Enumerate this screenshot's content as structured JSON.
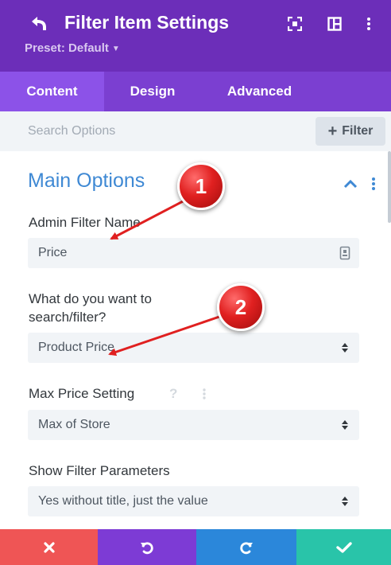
{
  "header": {
    "title": "Filter Item Settings",
    "preset_label": "Preset: Default",
    "icons": [
      "back-icon",
      "focus-icon",
      "layout-icon",
      "more-icon"
    ]
  },
  "tabs": [
    {
      "label": "Content",
      "active": true
    },
    {
      "label": "Design",
      "active": false
    },
    {
      "label": "Advanced",
      "active": false
    }
  ],
  "search": {
    "placeholder": "Search Options",
    "filter_label": "Filter"
  },
  "section": {
    "title": "Main Options"
  },
  "fields": [
    {
      "label": "Admin Filter Name",
      "value": "Price",
      "type": "text"
    },
    {
      "label_line1": "What do you want to",
      "label_line2": "search/filter?",
      "value": "Product Price",
      "type": "select"
    },
    {
      "label": "Max Price Setting",
      "value": "Max of Store",
      "type": "select",
      "help": "?"
    },
    {
      "label": "Show Filter Parameters",
      "value": "Yes without title, just the value",
      "type": "select"
    }
  ],
  "annotations": [
    {
      "number": "1"
    },
    {
      "number": "2"
    }
  ],
  "footer": {
    "buttons": [
      "discard-icon",
      "undo-icon",
      "redo-icon",
      "save-icon"
    ]
  },
  "colors": {
    "header": "#6c2eb9",
    "tabs": "#7b3fd1",
    "active_tab": "#8c52e8",
    "section_title": "#3f89d4",
    "discard": "#ef5555",
    "undo": "#7d3bd5",
    "redo": "#2b87da",
    "save": "#29c4a9",
    "annotation": "#e02020"
  }
}
